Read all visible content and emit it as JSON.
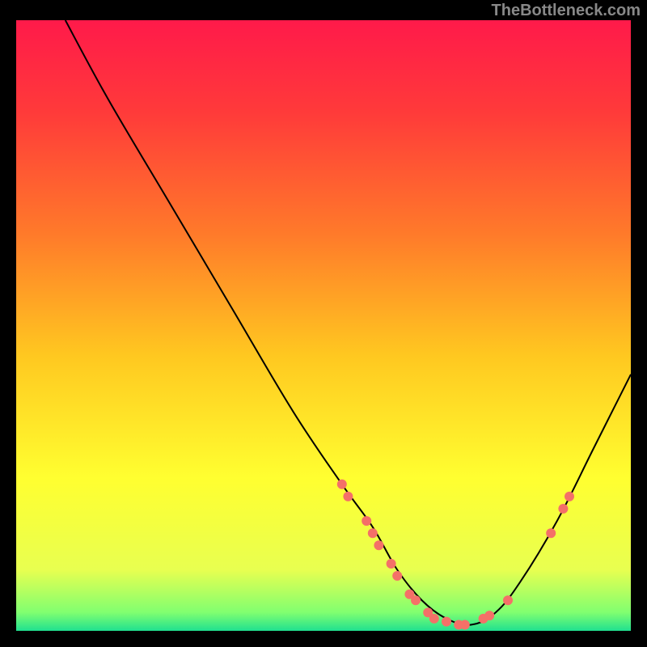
{
  "watermark": "TheBottleneck.com",
  "chart_data": {
    "type": "line",
    "title": "",
    "xlabel": "",
    "ylabel": "",
    "xlim": [
      0,
      100
    ],
    "ylim": [
      0,
      100
    ],
    "gradient_stops": [
      {
        "offset": 0,
        "color": "#ff1a4a"
      },
      {
        "offset": 15,
        "color": "#ff3a3a"
      },
      {
        "offset": 35,
        "color": "#ff7a2a"
      },
      {
        "offset": 55,
        "color": "#ffc820"
      },
      {
        "offset": 75,
        "color": "#ffff30"
      },
      {
        "offset": 90,
        "color": "#e8ff50"
      },
      {
        "offset": 97,
        "color": "#80ff70"
      },
      {
        "offset": 100,
        "color": "#20e090"
      }
    ],
    "series": [
      {
        "name": "bottleneck-curve",
        "x": [
          8,
          15,
          25,
          35,
          45,
          53,
          58,
          62,
          66,
          70,
          74,
          78,
          82,
          88,
          94,
          100
        ],
        "y": [
          100,
          87,
          70,
          53,
          36,
          24,
          17,
          10,
          5,
          2,
          1,
          3,
          8,
          18,
          30,
          42
        ]
      }
    ],
    "markers": {
      "name": "highlight-points",
      "color": "#f47068",
      "points": [
        {
          "x": 53,
          "y": 24
        },
        {
          "x": 54,
          "y": 22
        },
        {
          "x": 57,
          "y": 18
        },
        {
          "x": 58,
          "y": 16
        },
        {
          "x": 59,
          "y": 14
        },
        {
          "x": 61,
          "y": 11
        },
        {
          "x": 62,
          "y": 9
        },
        {
          "x": 64,
          "y": 6
        },
        {
          "x": 65,
          "y": 5
        },
        {
          "x": 67,
          "y": 3
        },
        {
          "x": 68,
          "y": 2
        },
        {
          "x": 70,
          "y": 1.5
        },
        {
          "x": 72,
          "y": 1
        },
        {
          "x": 73,
          "y": 1
        },
        {
          "x": 76,
          "y": 2
        },
        {
          "x": 77,
          "y": 2.5
        },
        {
          "x": 80,
          "y": 5
        },
        {
          "x": 87,
          "y": 16
        },
        {
          "x": 89,
          "y": 20
        },
        {
          "x": 90,
          "y": 22
        }
      ]
    }
  }
}
